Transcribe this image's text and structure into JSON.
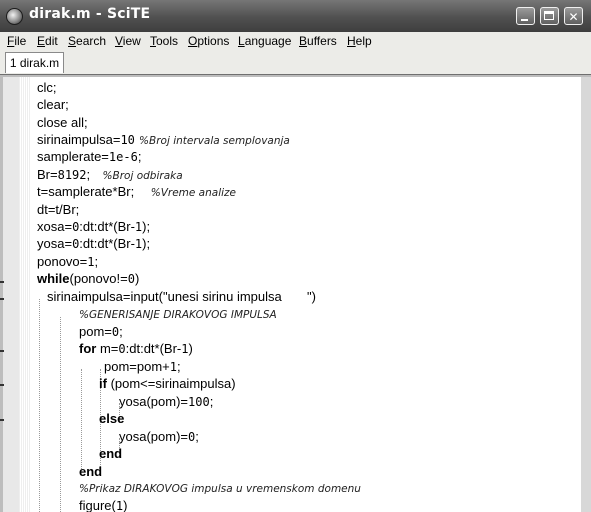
{
  "window": {
    "title": "dirak.m - SciTE",
    "buttons": {
      "minimize": "minimize",
      "maximize": "maximize",
      "close": "✕"
    }
  },
  "menu": [
    "File",
    "Edit",
    "Search",
    "View",
    "Tools",
    "Options",
    "Language",
    "Buffers",
    "Help"
  ],
  "menu_mnemonics": [
    "F",
    "E",
    "S",
    "V",
    "T",
    "O",
    "L",
    "B",
    "H"
  ],
  "tabs": [
    {
      "label": "1 dirak.m"
    }
  ],
  "code": {
    "l1": "clc;",
    "l2": "clear;",
    "l3": "close all;",
    "l4a": "sirinaimpulsa=",
    "l4n": "10",
    "l4c": "%Broj intervala semplovanja",
    "l5a": "samplerate=",
    "l5n": "1e-6",
    "l5b": ";",
    "l6a": "Br=",
    "l6n": "8192",
    "l6b": ";",
    "l6c": "%Broj odbiraka",
    "l7a": "t=samplerate*Br;",
    "l7c": "%Vreme analize",
    "l8": "dt=t/Br;",
    "l9a": "xosa=",
    "l9n": "0",
    "l9b": ":dt:dt*(Br-",
    "l9n2": "1",
    "l9c": ");",
    "l10a": "yosa=",
    "l10n": "0",
    "l10b": ":dt:dt*(Br-",
    "l10n2": "1",
    "l10c": ");",
    "l11a": "ponovo=",
    "l11n": "1",
    "l11b": ";",
    "l12k": "while",
    "l12a": "(ponovo!=",
    "l12n": "0",
    "l12b": ")",
    "l13a": "sirinaimpulsa=input(",
    "l13s": "\"unesi sirinu impulsa       \"",
    "l13b": ")",
    "l14c": "%GENERISANJE DIRAKOVOG IMPULSA",
    "l15a": "pom=",
    "l15n": "0",
    "l15b": ";",
    "l16k": "for",
    "l16a": " m=",
    "l16n": "0",
    "l16b": ":dt:dt*(Br-",
    "l16n2": "1",
    "l16c": ")",
    "l17a": "pom=pom+",
    "l17n": "1",
    "l17b": ";",
    "l18k": "if",
    "l18a": " (pom<=sirinaimpulsa)",
    "l19a": "yosa(pom)=",
    "l19n": "100",
    "l19b": ";",
    "l20k": "else",
    "l21a": "yosa(pom)=",
    "l21n": "0",
    "l21b": ";",
    "l22k": "end",
    "l23k": "end",
    "l24c": "%Prikaz DIRAKOVOG impulsa u vremenskom domenu",
    "l25a": "figure(",
    "l25n": "1",
    "l25b": ")"
  },
  "colors": {
    "titlebar": "#505050",
    "editor_bg": "#ffffff",
    "chrome": "#ecece8"
  }
}
